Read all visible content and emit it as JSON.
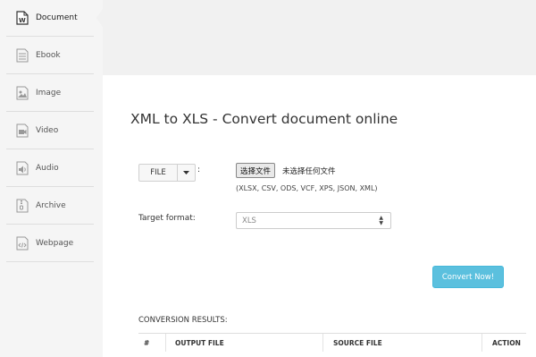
{
  "sidebar": {
    "items": [
      {
        "label": "Document",
        "icon": "document-w-icon"
      },
      {
        "label": "Ebook",
        "icon": "ebook-icon"
      },
      {
        "label": "Image",
        "icon": "image-icon"
      },
      {
        "label": "Video",
        "icon": "video-icon"
      },
      {
        "label": "Audio",
        "icon": "audio-icon"
      },
      {
        "label": "Archive",
        "icon": "archive-icon"
      },
      {
        "label": "Webpage",
        "icon": "webpage-icon"
      }
    ],
    "active_index": 0
  },
  "main": {
    "title": "XML to XLS - Convert document online",
    "source": {
      "button_label": "FILE",
      "colon": ":",
      "choose_file_label": "选择文件",
      "no_file_text": "未选择任何文件",
      "formats": "(XLSX, CSV, ODS, VCF, XPS, JSON, XML)"
    },
    "target": {
      "label": "Target format:",
      "selected": "XLS"
    },
    "convert_button": "Convert Now!",
    "results": {
      "label": "CONVERSION RESULTS:",
      "columns": [
        "#",
        "OUTPUT FILE",
        "SOURCE FILE",
        "ACTION"
      ]
    }
  },
  "colors": {
    "accent": "#5bc0de",
    "sidebar_bg": "#f5f5f5",
    "page_bg": "#f1f1f1"
  }
}
